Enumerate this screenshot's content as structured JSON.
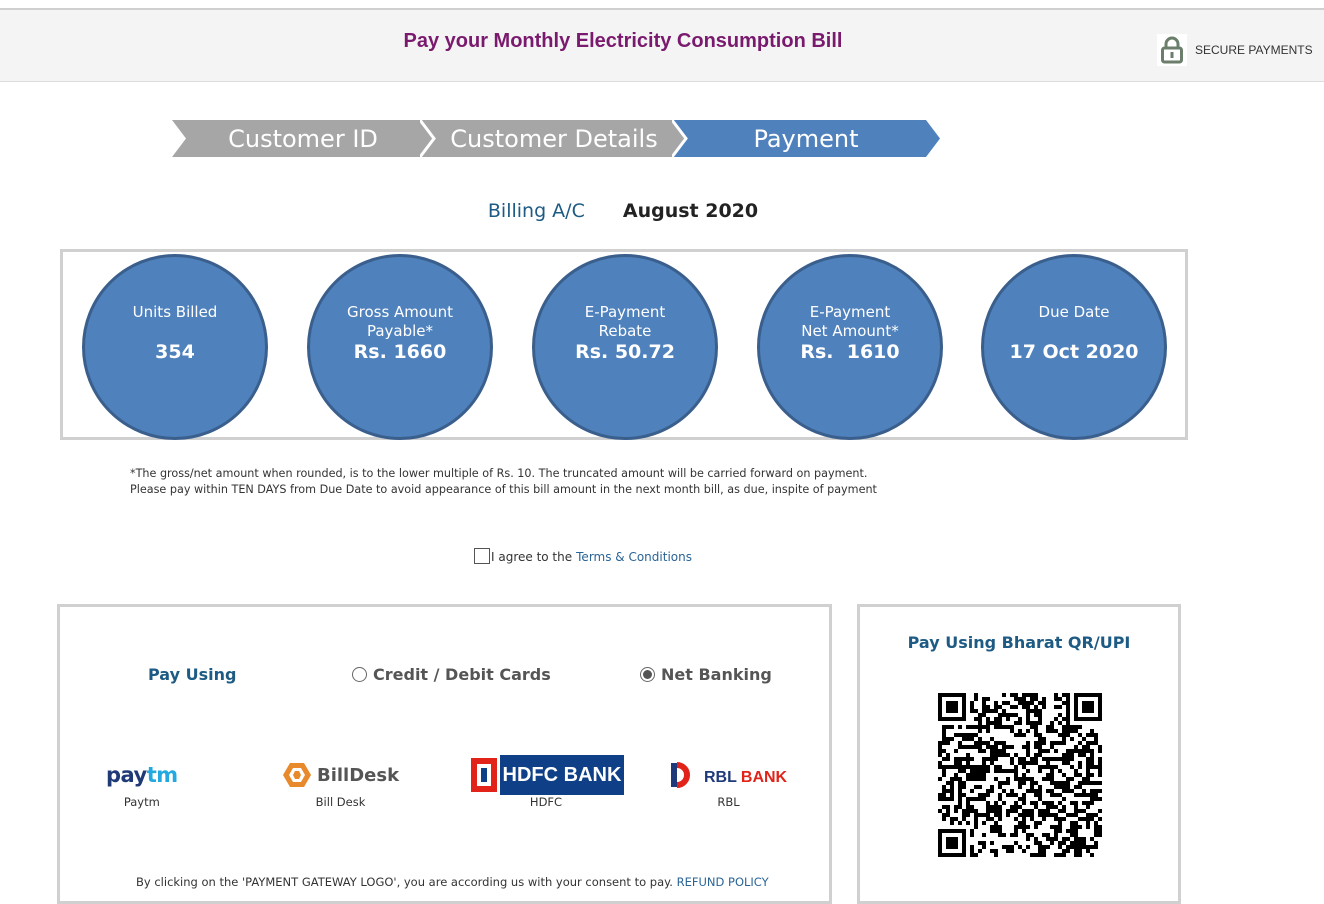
{
  "header": {
    "title": "Pay your Monthly Electricity Consumption Bill",
    "secure_label": "SECURE PAYMENTS"
  },
  "steps": [
    {
      "label": "Customer ID",
      "state": "done",
      "color": "#a6a6a6"
    },
    {
      "label": "Customer Details",
      "state": "done",
      "color": "#a6a6a6"
    },
    {
      "label": "Payment",
      "state": "active",
      "color": "#4f81bd"
    }
  ],
  "billing": {
    "label": "Billing A/C",
    "month": "August 2020"
  },
  "summary": [
    {
      "label_lines": [
        "Units Billed"
      ],
      "value": "354"
    },
    {
      "label_lines": [
        "Gross Amount",
        "Payable*"
      ],
      "value": "Rs. 1660"
    },
    {
      "label_lines": [
        "E-Payment",
        "Rebate"
      ],
      "value": "Rs. 50.72"
    },
    {
      "label_lines": [
        "E-Payment",
        "Net Amount*"
      ],
      "value": "Rs.  1610"
    },
    {
      "label_lines": [
        "Due Date"
      ],
      "value": "17 Oct 2020"
    }
  ],
  "notes": {
    "line1": "*The gross/net amount when rounded, is to the lower multiple of Rs. 10. The truncated amount will be carried forward on payment.",
    "line2": "Please pay within TEN DAYS from Due Date to avoid appearance of this bill amount in the next month bill, as due, inspite of payment"
  },
  "agree": {
    "text": "I agree to the",
    "link": "Terms & Conditions",
    "checked": false
  },
  "pay_panel": {
    "pay_using": "Pay Using",
    "options": [
      {
        "label": "Credit / Debit Cards",
        "selected": false
      },
      {
        "label": "Net Banking",
        "selected": true
      }
    ],
    "gateways": [
      {
        "name": "Paytm",
        "logo": "paytm-logo"
      },
      {
        "name": "Bill Desk",
        "logo": "billdesk-logo"
      },
      {
        "name": "HDFC",
        "logo": "hdfc-bank-logo"
      },
      {
        "name": "RBL",
        "logo": "rbl-bank-logo"
      }
    ],
    "consent_text": "By clicking on the 'PAYMENT GATEWAY LOGO', you are according us with your consent to pay.",
    "refund_link": "REFUND POLICY"
  },
  "qr_panel": {
    "title": "Pay Using Bharat QR/UPI"
  },
  "logos": {
    "paytm_a": "pay",
    "paytm_b": "tm",
    "billdesk": "BillDesk",
    "hdfc": "HDFC BANK",
    "rbl_a": "RBL",
    "rbl_b": "BANK"
  },
  "colors": {
    "title": "#7a1a6e",
    "accent": "#1d5b84",
    "circle": "#4f81bd"
  }
}
